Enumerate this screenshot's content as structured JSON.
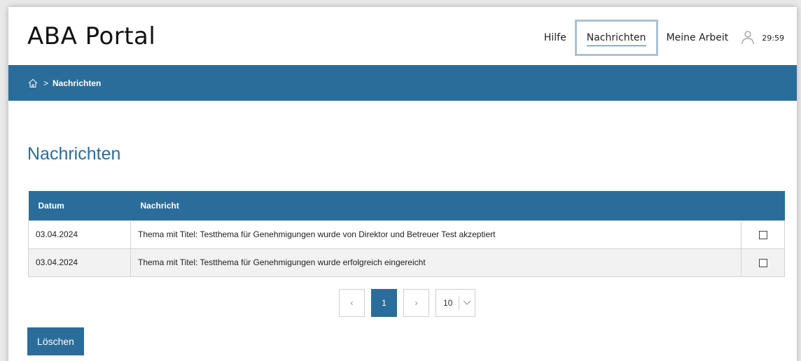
{
  "header": {
    "logo": "ABA Portal",
    "nav": {
      "help": "Hilfe",
      "messages": "Nachrichten",
      "my_work": "Meine Arbeit"
    },
    "user_icon": "user-icon",
    "timer": "29:59"
  },
  "breadcrumb": {
    "home_icon": "home-icon",
    "separator": ">",
    "current": "Nachrichten"
  },
  "main": {
    "title": "Nachrichten",
    "table": {
      "headers": [
        "Datum",
        "Nachricht",
        ""
      ],
      "rows": [
        {
          "date": "03.04.2024",
          "message": "Thema mit Titel: Testthema für Genehmigungen wurde von Direktor und Betreuer Test akzeptiert",
          "checked": false
        },
        {
          "date": "03.04.2024",
          "message": "Thema mit Titel: Testthema für Genehmigungen wurde erfolgreich eingereicht",
          "checked": false
        }
      ]
    },
    "pagination": {
      "prev": "‹",
      "current_page": "1",
      "next": "›",
      "page_size": "10"
    },
    "delete_label": "Löschen"
  },
  "colors": {
    "primary": "#2b6d9a",
    "active_nav_border": "#a9c2d6"
  }
}
